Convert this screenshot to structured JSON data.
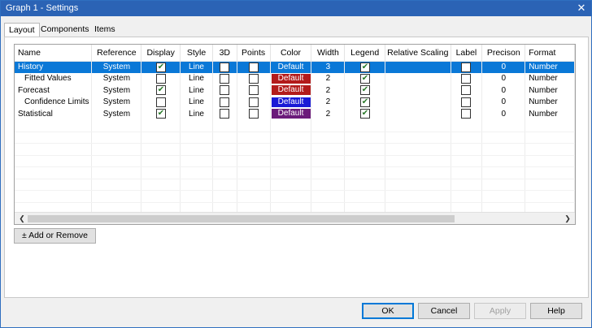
{
  "window": {
    "title": "Graph 1 - Settings"
  },
  "tabs": [
    {
      "label": "Layout"
    },
    {
      "label": "Components"
    },
    {
      "label": "Items"
    }
  ],
  "grid": {
    "columns": [
      "Name",
      "Reference",
      "Display",
      "Style",
      "3D",
      "Points",
      "Color",
      "Width",
      "Legend",
      "Relative Scaling",
      "Label",
      "Precison",
      "Format"
    ],
    "rows": [
      {
        "name": "History",
        "reference": "System",
        "display": true,
        "style": "Line",
        "three_d": false,
        "points": false,
        "color_label": "Default",
        "color": "#0a78d7",
        "width": "3",
        "legend": true,
        "relative_scaling": "",
        "label": false,
        "precision": "0",
        "format": "Number",
        "selected": true
      },
      {
        "name": "Fitted Values",
        "reference": "System",
        "display": false,
        "style": "Line",
        "three_d": false,
        "points": false,
        "color_label": "Default",
        "color": "#b31b1b",
        "width": "2",
        "legend": true,
        "relative_scaling": "",
        "label": false,
        "precision": "0",
        "format": "Number",
        "selected": false
      },
      {
        "name": "Forecast",
        "reference": "System",
        "display": true,
        "style": "Line",
        "three_d": false,
        "points": false,
        "color_label": "Default",
        "color": "#b31b1b",
        "width": "2",
        "legend": true,
        "relative_scaling": "",
        "label": false,
        "precision": "0",
        "format": "Number",
        "selected": false
      },
      {
        "name": "Confidence Limits",
        "reference": "System",
        "display": false,
        "style": "Line",
        "three_d": false,
        "points": false,
        "color_label": "Default",
        "color": "#1a1ad6",
        "width": "2",
        "legend": true,
        "relative_scaling": "",
        "label": false,
        "precision": "0",
        "format": "Number",
        "selected": false
      },
      {
        "name": "Statistical",
        "reference": "System",
        "display": true,
        "style": "Line",
        "three_d": false,
        "points": false,
        "color_label": "Default",
        "color": "#6b1a7a",
        "width": "2",
        "legend": true,
        "relative_scaling": "",
        "label": false,
        "precision": "0",
        "format": "Number",
        "selected": false
      }
    ]
  },
  "buttons": {
    "add_remove": "± Add or Remove",
    "ok": "OK",
    "cancel": "Cancel",
    "apply": "Apply",
    "help": "Help"
  },
  "icons": {
    "close": "close-icon",
    "scroll_left": "chevron-left-icon",
    "scroll_right": "chevron-right-icon"
  }
}
